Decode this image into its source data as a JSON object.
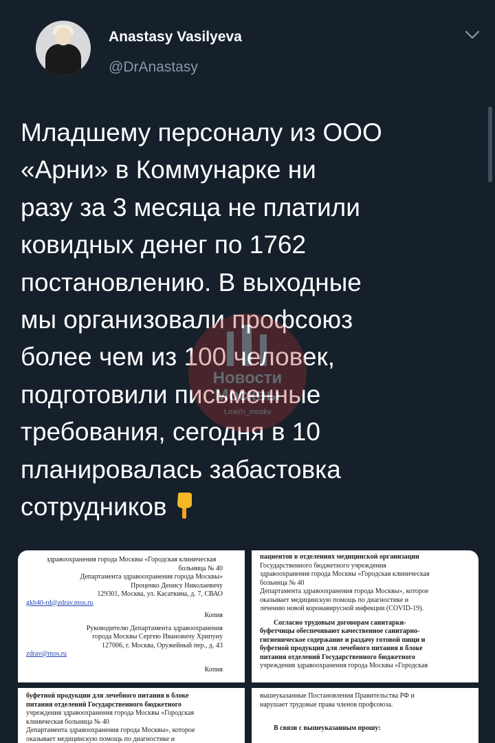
{
  "author": {
    "name": "Anastasy Vasilyeva",
    "handle": "@DrAnastasy"
  },
  "tweet": {
    "text": "Младшему персоналу из ООО\n«Арни» в Коммунарке ни\nразу за 3 месяца не платили\nковидных денег по 1762\nпостановлению. В выходные\nмы организовали профсоюз\nболее чем из 100 человек,\nподготовили письменные\nтребования, сегодня в 10\nпланировалась забастовка\nсотрудников",
    "emoji": "backhand-index-pointing-down"
  },
  "watermark": {
    "line1": "Новости",
    "line2": "Москвы",
    "line3": "t.me/n_moskv"
  },
  "documents": {
    "doc1": {
      "lines": [
        "здравоохранения города Москвы «Городская клиническая",
        "больница № 40",
        "Департамента здравоохранения города Москвы»",
        "Проценко Денису Николаевичу",
        "129301, Москва, ул. Касаткина, д. 7, СВАО",
        "gkb40-rd@zdrav.mos.ru",
        "Копия",
        "Руководителю Департамента здравоохранения",
        "города Москвы Сергею Ивановичу Хрипуну",
        "127006, г. Москва, Оружейный пер., д. 43",
        "zdrav@mos.ru",
        "Копия"
      ]
    },
    "doc2": {
      "lines": [
        "пациентов в отделениях медицинской организации",
        "Государственного бюджетного учреждения",
        "здравоохранения города Москвы «Городская клиническая",
        "больница № 40",
        "Департамента здравоохранения города Москвы», которое",
        "оказывает медицинскую помощь по диагностике и",
        "лечению новой коронавирусной инфекции (COVID-19).",
        "Согласно трудовым договорам санитарки-",
        "буфетчицы обеспечивают качественное санитарно-",
        "гигиеническое содержание и раздачу готовой пищи и",
        "буфетной продукции для лечебного питания в блоке",
        "питания отделений Государственного бюджетного",
        "учреждения здравоохранения города Москвы «Городская"
      ]
    },
    "doc3": {
      "lines": [
        "буфетной продукции для лечебного питания в блоке",
        "питания отделений Государственного бюджетного",
        "учреждения здравоохранения города Москвы «Городская",
        "клиническая больница № 40",
        "Департамента здравоохранения города Москвы», которое",
        "оказывает медицинскую помощь по диагностике и"
      ]
    },
    "doc4": {
      "lines": [
        "вышеуказанные Постановления Правительства РФ и",
        "нарушает трудовые права членов профсоюза.",
        "В связи с вышеуказанным прошу:"
      ]
    }
  },
  "colors": {
    "background": "#15202b",
    "text": "#ffffff",
    "secondary": "#8899a6"
  }
}
